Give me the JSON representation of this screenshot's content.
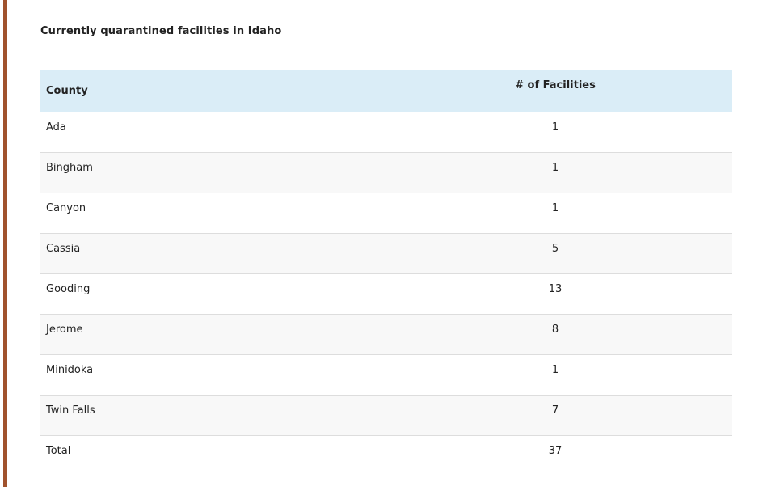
{
  "caption": "Currently quarantined facilities in Idaho",
  "table": {
    "headers": {
      "county": "County",
      "facilities": "# of Facilities"
    },
    "rows": [
      {
        "county": "Ada",
        "facilities": "1"
      },
      {
        "county": "Bingham",
        "facilities": "1"
      },
      {
        "county": "Canyon",
        "facilities": "1"
      },
      {
        "county": "Cassia",
        "facilities": "5"
      },
      {
        "county": "Gooding",
        "facilities": "13"
      },
      {
        "county": "Jerome",
        "facilities": "8"
      },
      {
        "county": "Minidoka",
        "facilities": "1"
      },
      {
        "county": "Twin Falls",
        "facilities": "7"
      },
      {
        "county": "Total",
        "facilities": "37"
      }
    ]
  },
  "colors": {
    "accent": "#a0522d",
    "header_bg": "#daedf7",
    "stripe_bg": "#f8f8f8",
    "border": "#dddddd"
  }
}
